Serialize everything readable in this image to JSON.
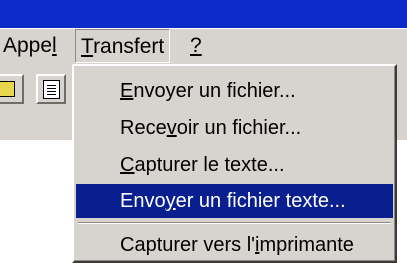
{
  "menubar": {
    "items": [
      {
        "label": "Appel",
        "mnemonic": "l"
      },
      {
        "label": "Transfert",
        "mnemonic": "T",
        "active": true
      },
      {
        "label": "?",
        "mnemonic": "?"
      }
    ]
  },
  "toolbar": {
    "buttons": [
      {
        "icon": "connect-icon"
      },
      {
        "icon": "properties-icon"
      }
    ]
  },
  "dropdown": {
    "items": [
      {
        "label": "Envoyer un fichier...",
        "mnemonic": "E",
        "selected": false
      },
      {
        "label": "Recevoir un fichier...",
        "mnemonic": "v",
        "selected": false
      },
      {
        "label": "Capturer le texte...",
        "mnemonic": "C",
        "selected": false
      },
      {
        "label": "Envoyer un fichier texte...",
        "mnemonic": "y",
        "selected": true
      },
      {
        "label": "Capturer vers l'imprimante",
        "mnemonic": "i",
        "selected": false
      }
    ]
  },
  "colors": {
    "titlebar": "#0c2bc9",
    "face": "#d7d3ce",
    "selection": "#0a1f8f"
  }
}
